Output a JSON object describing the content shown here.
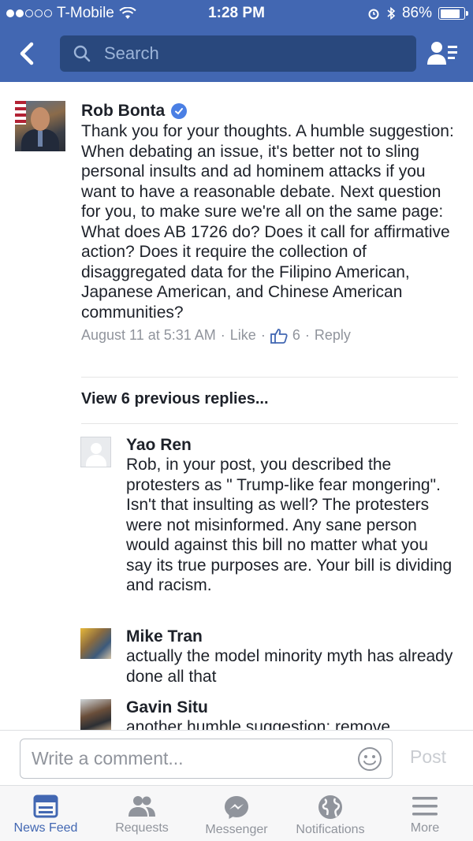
{
  "status_bar": {
    "carrier": "T-Mobile",
    "time": "1:28 PM",
    "battery": "86%",
    "battery_level": 0.86
  },
  "nav": {
    "search_placeholder": "Search"
  },
  "main_comment": {
    "author": "Rob Bonta",
    "verified": true,
    "text": "Thank you for your thoughts.  A humble suggestion:  When debating an issue, it's better not to sling personal insults and ad hominem attacks if you want to have a reasonable debate.  Next question for you, to make sure we're all on the same page:  What does AB 1726 do?  Does it call for affirmative action? Does it require the collection of disaggregated data for the Filipino American, Japanese American, and Chinese American communities?",
    "timestamp": "August 11 at 5:31 AM",
    "like_label": "Like",
    "like_count": "6",
    "reply_label": "Reply",
    "separator": "·"
  },
  "view_previous": "View 6 previous replies...",
  "replies": [
    {
      "name": "Yao Ren",
      "text": "Rob, in your post, you described the protesters as \" Trump-like fear mongering\". Isn't that insulting as well? The protesters were not misinformed. Any sane person would against this bill no matter what you say its true purposes are. Your bill is dividing and racism."
    },
    {
      "name": "Mike Tran",
      "text": "actually the model minority myth has already done all that"
    },
    {
      "name": "Gavin Situ",
      "text": "another humble suggestion: remove"
    }
  ],
  "composer": {
    "placeholder": "Write a comment...",
    "post_label": "Post"
  },
  "tabs": [
    {
      "label": "News Feed",
      "icon": "news-feed-icon",
      "active": true
    },
    {
      "label": "Requests",
      "icon": "requests-icon",
      "active": false
    },
    {
      "label": "Messenger",
      "icon": "messenger-icon",
      "active": false
    },
    {
      "label": "Notifications",
      "icon": "globe-icon",
      "active": false
    },
    {
      "label": "More",
      "icon": "menu-icon",
      "active": false
    }
  ],
  "colors": {
    "brand_blue": "#4267b2",
    "search_bg": "#29487d",
    "meta_gray": "#90949c",
    "verified_blue": "#4a7fe4"
  }
}
